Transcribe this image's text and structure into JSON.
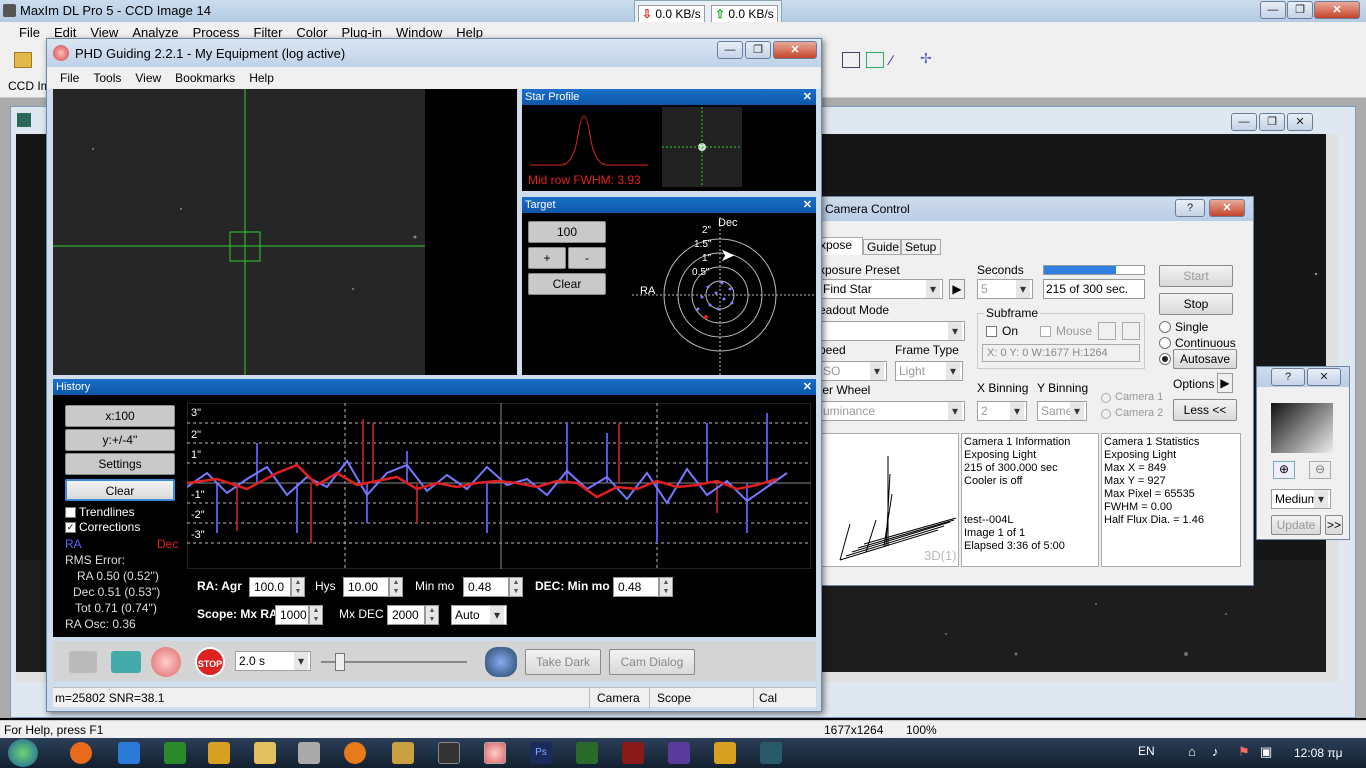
{
  "maxim": {
    "title": "MaxIm DL Pro 5 - CCD Image 14",
    "menu": [
      "File",
      "Edit",
      "View",
      "Analyze",
      "Process",
      "Filter",
      "Color",
      "Plug-in",
      "Window",
      "Help"
    ],
    "ccd_label": "CCD Im",
    "status_left": "For Help, press F1",
    "status_dims": "1677x1264",
    "status_zoom": "100%"
  },
  "network": {
    "down": "0.0 KB/s",
    "up": "0.0 KB/s"
  },
  "phd": {
    "title": "PHD Guiding 2.2.1 - My Equipment (log active)",
    "menu": [
      "File",
      "Tools",
      "View",
      "Bookmarks",
      "Help"
    ],
    "star_profile": {
      "title": "Star Profile",
      "fwhm_label": "Mid row FWHM: 3.93"
    },
    "target": {
      "title": "Target",
      "scale": "100",
      "plus": "+",
      "minus": "-",
      "clear": "Clear",
      "ra_label": "RA",
      "dec_label": "Dec",
      "rings": [
        "2\"",
        "1.5\"",
        "1\"",
        "0.5\""
      ]
    },
    "history": {
      "title": "History",
      "x_scale": "x:100",
      "y_scale": "y:+/-4''",
      "settings": "Settings",
      "clear": "Clear",
      "trendlines": "Trendlines",
      "corrections": "Corrections",
      "ra": "RA",
      "dec": "Dec",
      "rms_error": "RMS Error:",
      "ra_rms": "RA 0.50 (0.52'')",
      "dec_rms": "Dec 0.51 (0.53'')",
      "tot_rms": "Tot 0.71 (0.74'')",
      "ra_osc": "RA Osc: 0.36",
      "y_ticks": [
        "3\"",
        "2\"",
        "1\"",
        "-1\"",
        "-2\"",
        "-3\""
      ]
    },
    "params": {
      "ra_agr_label": "RA: Agr",
      "ra_agr": "100.0",
      "hys_label": "Hys",
      "hys": "10.00",
      "min_mo_label": "Min mo",
      "min_mo": "0.48",
      "dec_label": "DEC: Min mo",
      "dec_min_mo": "0.48",
      "scope_label": "Scope: Mx RA",
      "mx_ra": "1000",
      "mx_dec_label": "Mx DEC",
      "mx_dec": "2000",
      "auto": "Auto"
    },
    "toolbar": {
      "exposure": "2.0 s",
      "take_dark": "Take Dark",
      "cam_dialog": "Cam Dialog",
      "stop": "STOP"
    },
    "status": {
      "snr": "m=25802 SNR=38.1",
      "camera": "Camera",
      "scope": "Scope",
      "cal": "Cal"
    }
  },
  "camera_control": {
    "title": "Camera Control",
    "tabs": [
      "xpose",
      "Guide",
      "Setup"
    ],
    "exposure_preset_label": "xposure Preset",
    "preset_value": "Find Star",
    "seconds_label": "Seconds",
    "seconds_value": "5",
    "progress_text": "215 of 300 sec.",
    "progress_fraction": 0.72,
    "start": "Start",
    "stop": "Stop",
    "readout_label": "eadout Mode",
    "subframe_label": "Subframe",
    "on_label": "On",
    "mouse_label": "Mouse",
    "subframe_coords": "X: 0 Y: 0 W:1677 H:1264",
    "speed_label": "peed",
    "speed_value": "SO",
    "frame_type_label": "Frame Type",
    "frame_type_value": "Light",
    "single": "Single",
    "continuous": "Continuous",
    "autosave": "Autosave",
    "options": "Options",
    "filter_wheel_label": "ter Wheel",
    "filter_value": "uminance",
    "xbin_label": "X Binning",
    "xbin_value": "2",
    "ybin_label": "Y Binning",
    "ybin_value": "Same",
    "camera1": "Camera 1",
    "camera2": "Camera 2",
    "less": "Less <<",
    "info": [
      "Camera 1 Information",
      "Exposing Light",
      "215 of 300.000 sec",
      "Cooler is off",
      "",
      "",
      "test--004L",
      "Image 1 of 1",
      "Elapsed 3:36 of 5:00"
    ],
    "stats": [
      "Camera 1 Statistics",
      "Exposing Light",
      "Max X = 849",
      "Max Y = 927",
      "Max Pixel = 65535",
      "FWHM = 0.00",
      "Half Flux Dia. = 1.46"
    ],
    "graph_label": "3D(1)"
  },
  "side_panel": {
    "zoom_value": "Medium",
    "update": "Update",
    "more": ">>"
  },
  "taskbar": {
    "lang": "EN",
    "time": "12:08 πμ"
  }
}
